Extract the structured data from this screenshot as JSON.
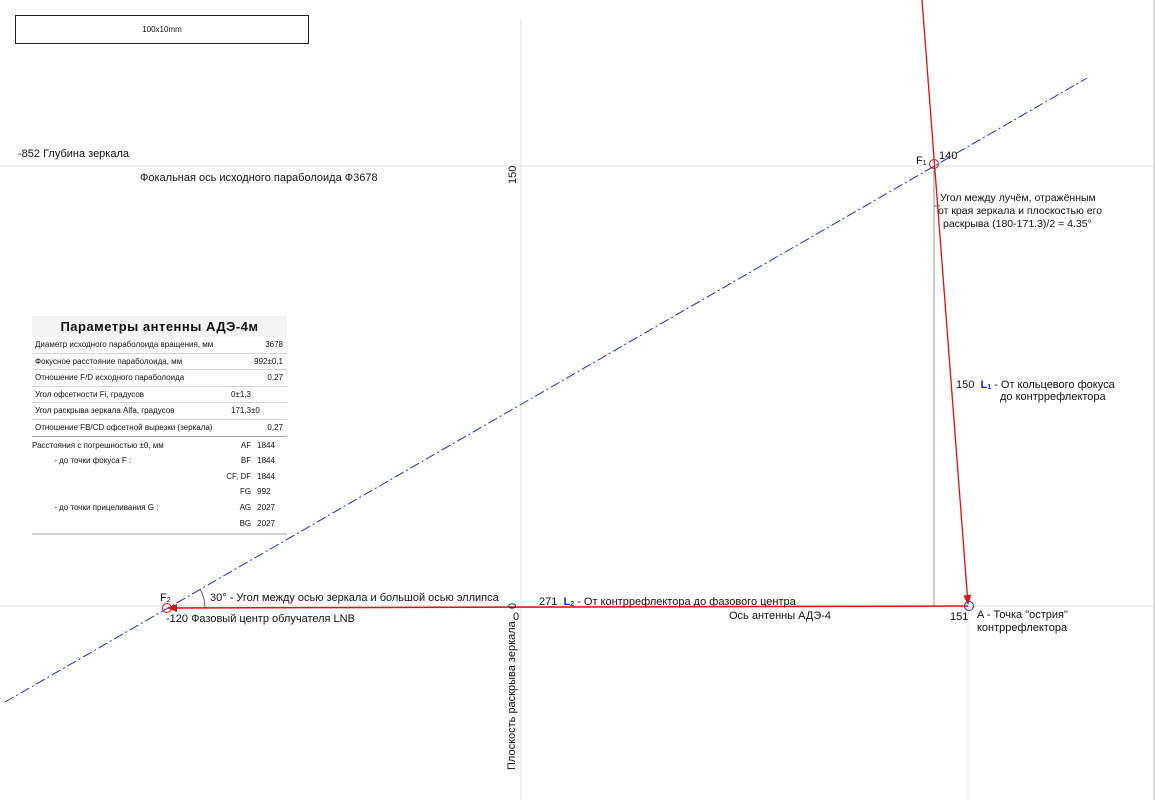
{
  "scale_label": "100x10mm",
  "mirror_depth": "-852  Глубина зеркала",
  "focal_axis_label": "Фокальная ось исходного параболоида Ф3678",
  "vertical_150": "150",
  "vertical_0": "0",
  "f1_label": "F",
  "f1_sub": "1",
  "f1_value": "140",
  "angle_note": {
    "line1": "Угол между лучём, отражённым",
    "line2": "от края зеркала и плоскостью его",
    "line3": "раскрыва (180-171.3)/2 = 4.35°"
  },
  "l1": {
    "value": "150",
    "name": "L",
    "sub": "1",
    "text": " - От кольцевого фокуса",
    "text2": "до контррефлектора"
  },
  "f2_label": "F",
  "f2_sub": "2",
  "angle30": "30° - Угол между осью зеркала и большой осью эллипса",
  "l2": {
    "value": "271",
    "name": "L",
    "sub": "2",
    "text": " - От контррефлектора  до фазового центра"
  },
  "phase_center": "-120  Фазовый центр облучателя LNB",
  "zero_label": "0",
  "antenna_axis": "Ось антенны АДЭ-4",
  "point_a_value": "151",
  "point_a_line1": "A - Точка \"острия\"",
  "point_a_line2": "контррефлектора",
  "aperture_plane": "Плоскость раскрыва зеркала",
  "table": {
    "title": "Параметры  антенны  АДЭ-4м",
    "rows": [
      {
        "name": "Диаметр исходного параболоида вращения, мм",
        "value": "3678"
      },
      {
        "name": "Фокусное  расстояние  параболоида, мм",
        "value": "992±0,1"
      },
      {
        "name": "Отношение  F/D  исходного  параболоида",
        "value": "0,27"
      },
      {
        "name": "Угол  офсетности Fi, градусов",
        "value": "0±1,3"
      },
      {
        "name": "Угол  раскрыва  зеркала  Alfa, градусов",
        "value": "171,3±0"
      },
      {
        "name": "Отношение  FB/CD офсетной  вырезки (зеркала)",
        "value": "0,27"
      }
    ],
    "distances": [
      {
        "name": "Расстояния с погрешностью ±0, мм",
        "code": "AF",
        "value": "1844"
      },
      {
        "name": "          - до точки фокуса F :",
        "code": "BF",
        "value": "1844"
      },
      {
        "name": "",
        "code": "CF, DF",
        "value": "1844"
      },
      {
        "name": "",
        "code": "FG",
        "value": "992"
      },
      {
        "name": "          - до точки прицеливания G :",
        "code": "AG",
        "value": "2027"
      },
      {
        "name": "",
        "code": "BG",
        "value": "2027"
      }
    ]
  },
  "colors": {
    "ray": "#e01010",
    "focal_axis": "#2a2ad0",
    "guide": "#bdbdbd",
    "blue_label": "#1a1aff"
  }
}
